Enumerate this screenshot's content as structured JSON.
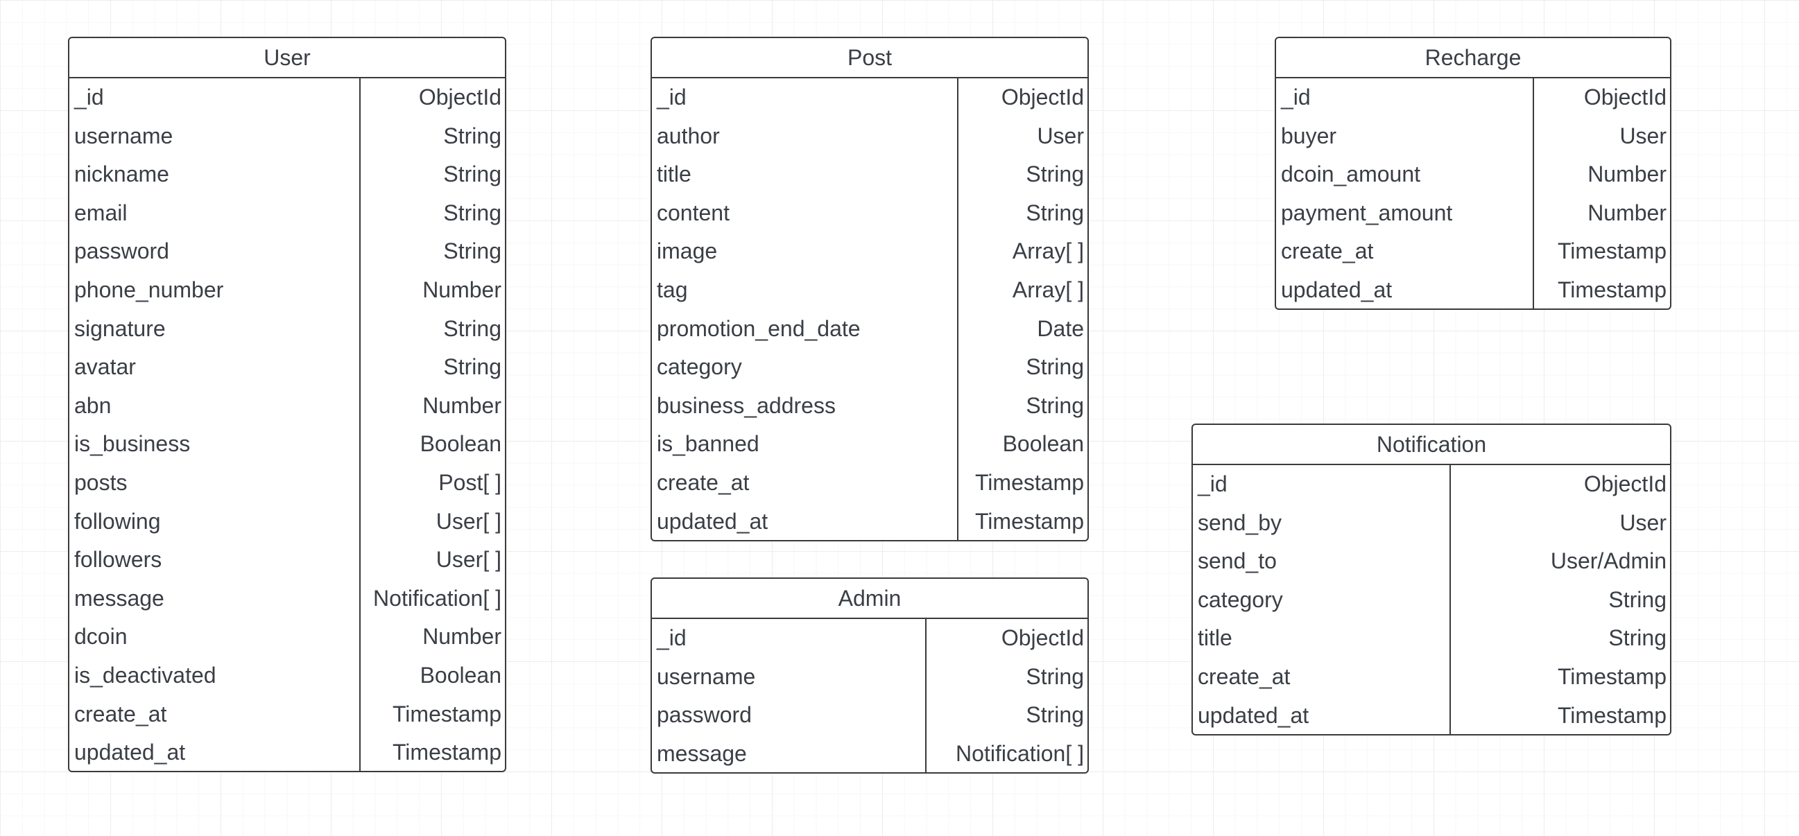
{
  "entities": {
    "user": {
      "title": "User",
      "fields": [
        {
          "name": "_id",
          "type": "ObjectId"
        },
        {
          "name": "username",
          "type": "String"
        },
        {
          "name": "nickname",
          "type": "String"
        },
        {
          "name": "email",
          "type": "String"
        },
        {
          "name": "password",
          "type": "String"
        },
        {
          "name": "phone_number",
          "type": "Number"
        },
        {
          "name": "signature",
          "type": "String"
        },
        {
          "name": "avatar",
          "type": "String"
        },
        {
          "name": "abn",
          "type": "Number"
        },
        {
          "name": "is_business",
          "type": "Boolean"
        },
        {
          "name": "posts",
          "type": "Post[ ]"
        },
        {
          "name": "following",
          "type": "User[ ]"
        },
        {
          "name": "followers",
          "type": "User[ ]"
        },
        {
          "name": "message",
          "type": "Notification[ ]"
        },
        {
          "name": "dcoin",
          "type": "Number"
        },
        {
          "name": "is_deactivated",
          "type": "Boolean"
        },
        {
          "name": "create_at",
          "type": "Timestamp"
        },
        {
          "name": "updated_at",
          "type": "Timestamp"
        }
      ]
    },
    "post": {
      "title": "Post",
      "fields": [
        {
          "name": "_id",
          "type": "ObjectId"
        },
        {
          "name": "author",
          "type": "User"
        },
        {
          "name": "title",
          "type": "String"
        },
        {
          "name": "content",
          "type": "String"
        },
        {
          "name": "image",
          "type": "Array[ ]"
        },
        {
          "name": "tag",
          "type": "Array[ ]"
        },
        {
          "name": "promotion_end_date",
          "type": "Date"
        },
        {
          "name": "category",
          "type": "String"
        },
        {
          "name": "business_address",
          "type": "String"
        },
        {
          "name": "is_banned",
          "type": "Boolean"
        },
        {
          "name": "create_at",
          "type": "Timestamp"
        },
        {
          "name": "updated_at",
          "type": "Timestamp"
        }
      ]
    },
    "admin": {
      "title": "Admin",
      "fields": [
        {
          "name": "_id",
          "type": "ObjectId"
        },
        {
          "name": "username",
          "type": "String"
        },
        {
          "name": "password",
          "type": "String"
        },
        {
          "name": "message",
          "type": "Notification[ ]"
        }
      ]
    },
    "recharge": {
      "title": "Recharge",
      "fields": [
        {
          "name": "_id",
          "type": "ObjectId"
        },
        {
          "name": "buyer",
          "type": "User"
        },
        {
          "name": "dcoin_amount",
          "type": "Number"
        },
        {
          "name": "payment_amount",
          "type": "Number"
        },
        {
          "name": "create_at",
          "type": "Timestamp"
        },
        {
          "name": "updated_at",
          "type": "Timestamp"
        }
      ]
    },
    "notification": {
      "title": "Notification",
      "fields": [
        {
          "name": "_id",
          "type": "ObjectId"
        },
        {
          "name": "send_by",
          "type": "User"
        },
        {
          "name": "send_to",
          "type": "User/Admin"
        },
        {
          "name": "category",
          "type": "String"
        },
        {
          "name": "title",
          "type": "String"
        },
        {
          "name": "create_at",
          "type": "Timestamp"
        },
        {
          "name": "updated_at",
          "type": "Timestamp"
        }
      ]
    }
  }
}
